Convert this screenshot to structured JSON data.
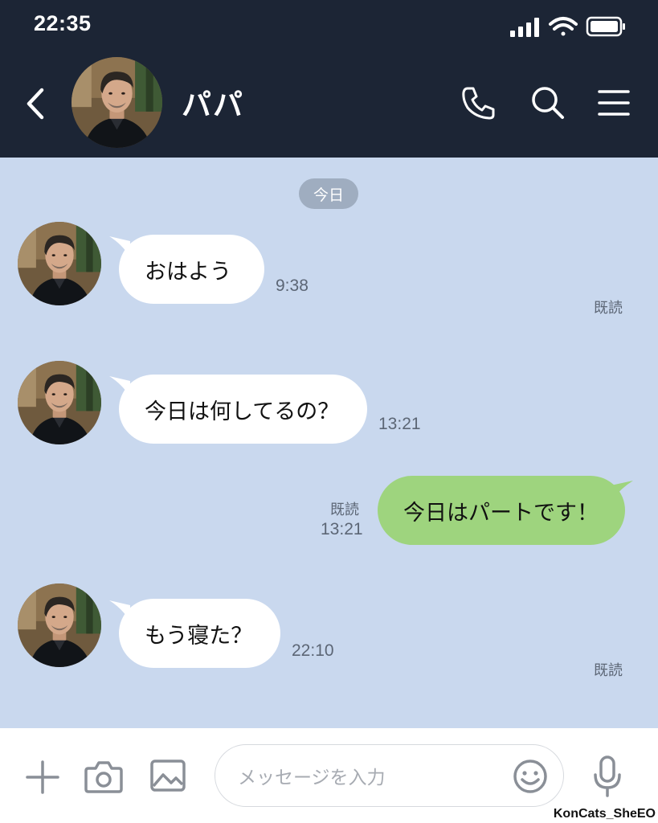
{
  "status_bar": {
    "time": "22:35"
  },
  "header": {
    "contact_name": "パパ",
    "icons": [
      "back-chevron-icon",
      "phone-icon",
      "search-icon",
      "menu-icon"
    ]
  },
  "chat": {
    "date_chip": "今日",
    "messages": [
      {
        "direction": "in",
        "text": "おはよう",
        "time": "9:38"
      },
      {
        "direction": "in",
        "text": "今日は何してるの？",
        "time": "13:21"
      },
      {
        "direction": "out",
        "text": "今日はパートです！",
        "time": "13:21",
        "read": "既読"
      },
      {
        "direction": "in",
        "text": "もう寝た？",
        "time": "22:10"
      }
    ],
    "read_markers": [
      "既読",
      "既読"
    ]
  },
  "footer": {
    "input_placeholder": "メッセージを入力",
    "icons": [
      "plus-icon",
      "camera-icon",
      "image-icon",
      "emoji-icon",
      "mic-icon"
    ]
  },
  "watermark": "KonCats_SheEO",
  "colors": {
    "header_bg": "#1c2535",
    "chat_bg": "#c9d8ee",
    "incoming_bubble": "#ffffff",
    "outgoing_bubble": "#9ed47e",
    "date_chip_bg": "#9fadc0"
  }
}
